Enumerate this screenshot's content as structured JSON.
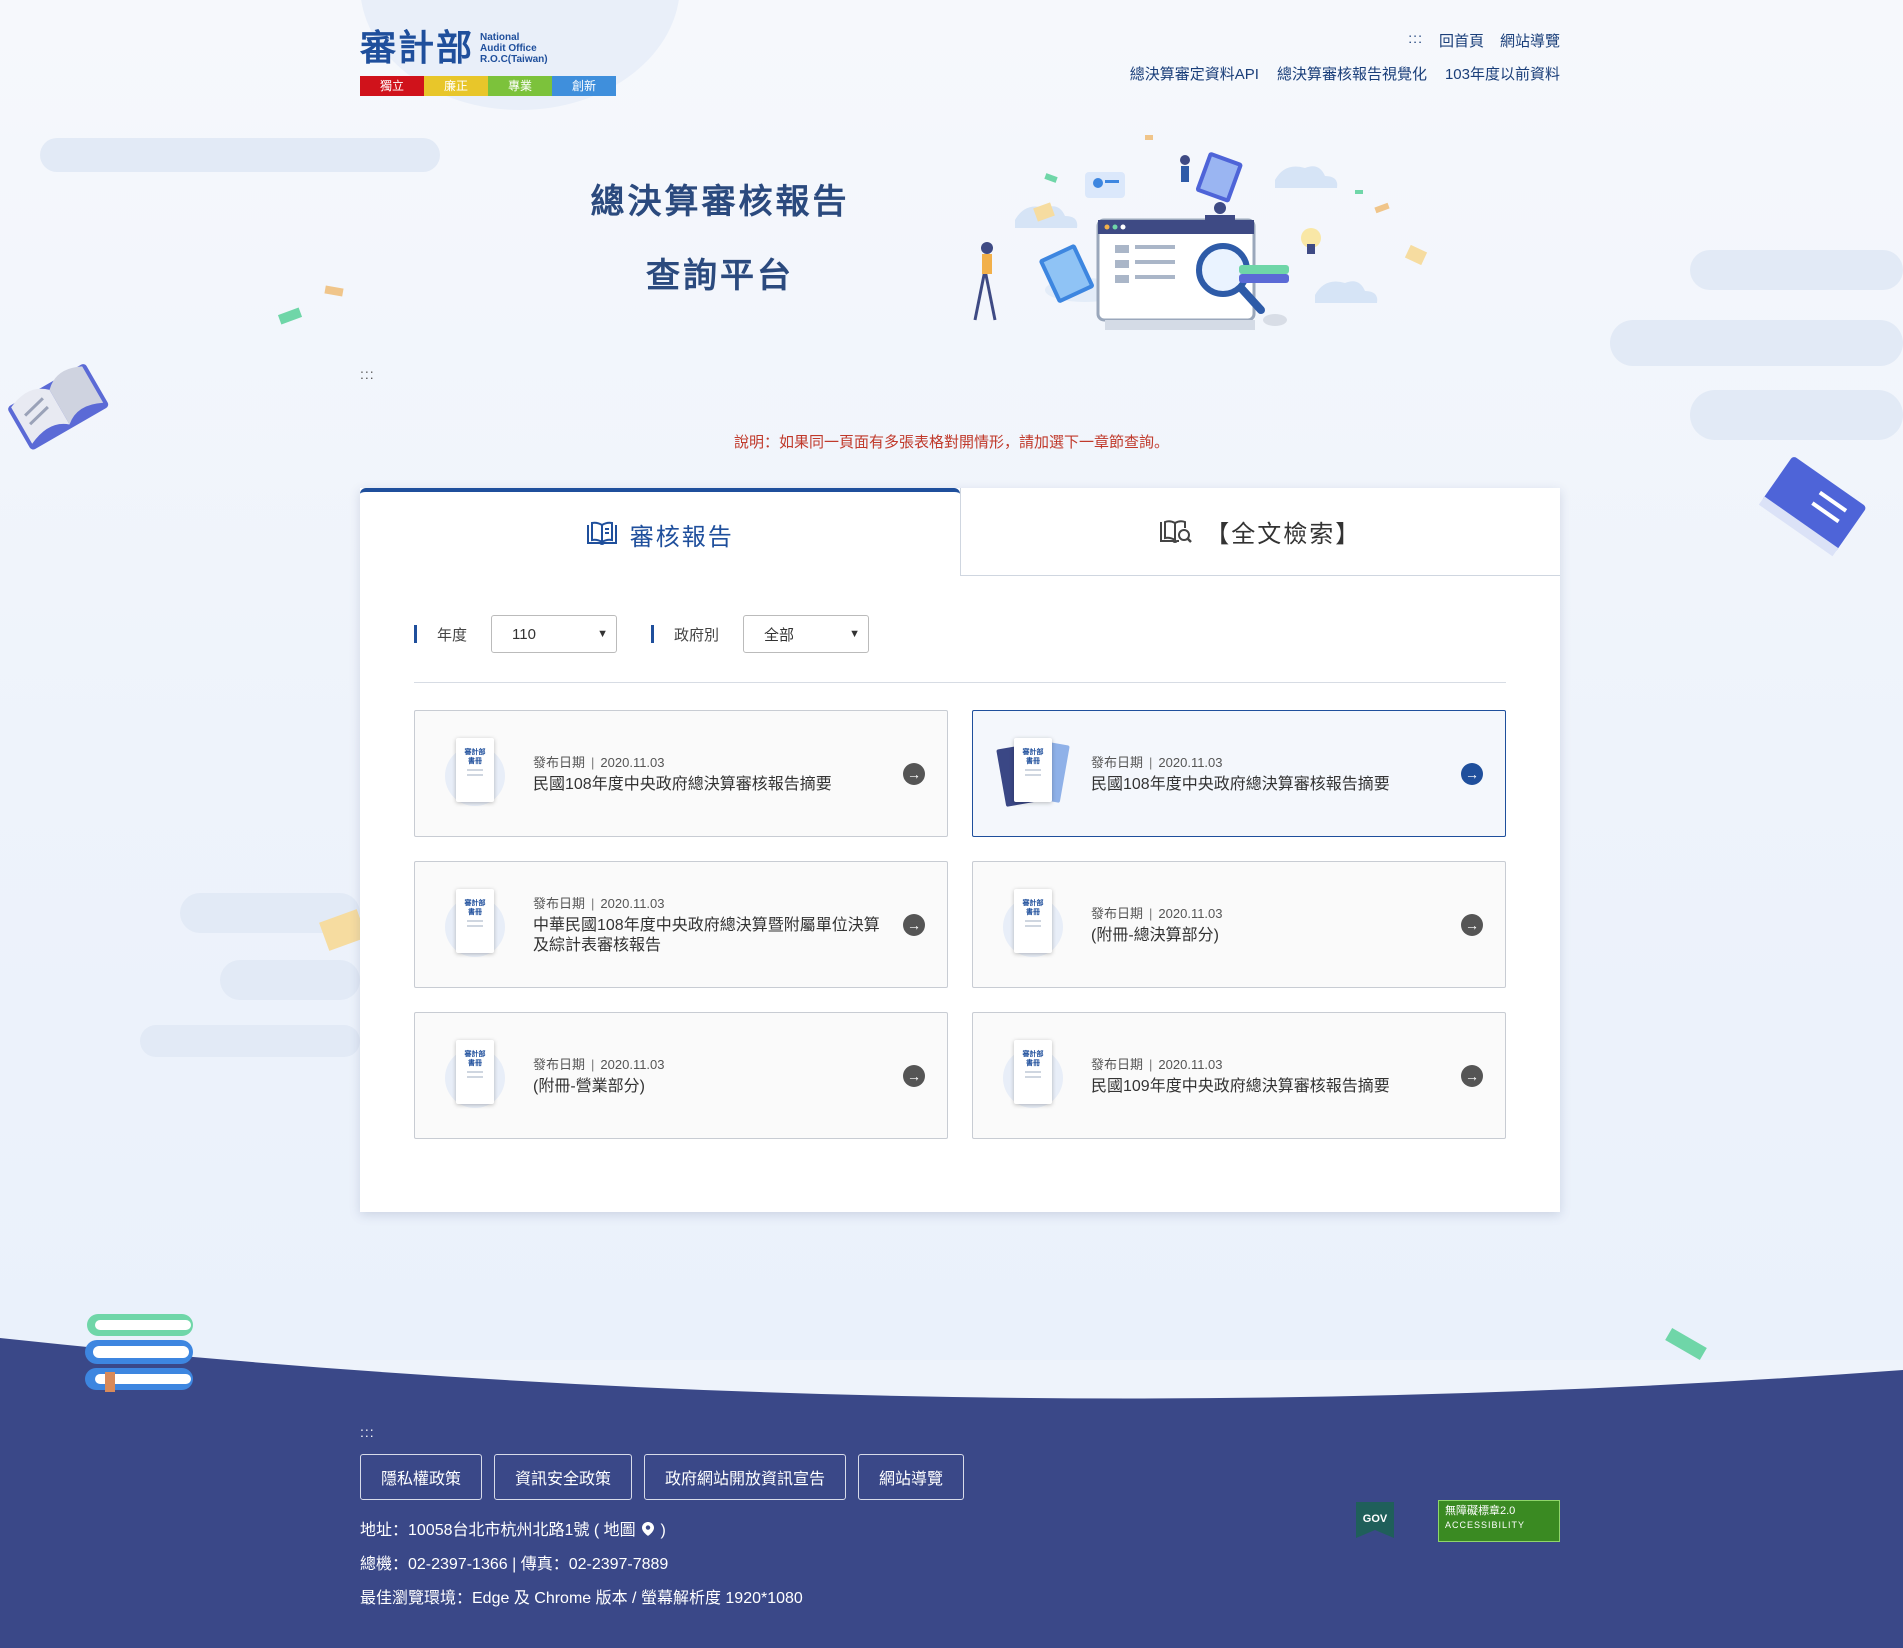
{
  "header": {
    "logo_zh": "審計部",
    "logo_en": [
      "National",
      "Audit Office",
      "R.O.C(Taiwan)"
    ],
    "slogans": [
      {
        "text": "獨立",
        "color": "#d0121b"
      },
      {
        "text": "廉正",
        "color": "#e8c62a"
      },
      {
        "text": "專業",
        "color": "#7cc23b"
      },
      {
        "text": "創新",
        "color": "#3f8fdc"
      }
    ],
    "accesskey": ":::",
    "home_link": "回首頁",
    "sitemap_link": "網站導覽",
    "links": [
      "總決算審定資料API",
      "總決算審核報告視覺化",
      "103年度以前資料"
    ]
  },
  "hero": {
    "title_line1": "總決算審核報告",
    "title_line2": "查詢平台"
  },
  "main_accesskey": ":::",
  "note": "說明：如果同一頁面有多張表格對開情形，請加選下一章節查詢。",
  "tabs": {
    "report_label": "審核報告",
    "search_label": "【全文檢索】"
  },
  "filters": {
    "year_label": "年度",
    "year_value": "110",
    "gov_label": "政府別",
    "gov_value": "全部"
  },
  "reports": [
    {
      "date_label": "發布日期",
      "date": "2020.11.03",
      "icon_label1": "審計部",
      "icon_label2": "書冊",
      "title": "民國108年度中央政府總決算審核報告摘要",
      "highlight": false
    },
    {
      "date_label": "發布日期",
      "date": "2020.11.03",
      "icon_label1": "審計部",
      "icon_label2": "書冊",
      "title": "民國108年度中央政府總決算審核報告摘要",
      "highlight": true
    },
    {
      "date_label": "發布日期",
      "date": "2020.11.03",
      "icon_label1": "審計部",
      "icon_label2": "書冊",
      "title": "中華民國108年度中央政府總決算暨附屬單位決算及綜計表審核報告",
      "highlight": false
    },
    {
      "date_label": "發布日期",
      "date": "2020.11.03",
      "icon_label1": "審計部",
      "icon_label2": "書冊",
      "title": "(附冊-總決算部分)",
      "highlight": false
    },
    {
      "date_label": "發布日期",
      "date": "2020.11.03",
      "icon_label1": "審計部",
      "icon_label2": "書冊",
      "title": "(附冊-營業部分)",
      "highlight": false
    },
    {
      "date_label": "發布日期",
      "date": "2020.11.03",
      "icon_label1": "審計部",
      "icon_label2": "書冊",
      "title": "民國109年度中央政府總決算審核報告摘要",
      "highlight": false
    }
  ],
  "footer": {
    "accesskey": ":::",
    "buttons": [
      "隱私權政策",
      "資訊安全政策",
      "政府網站開放資訊宣告",
      "網站導覽"
    ],
    "address": "地址：10058台北市杭州北路1號 ( 地圖",
    "address_end": ")",
    "phone": "總機：02-2397-1366 | 傳真：02-2397-7889",
    "browser": "最佳瀏覽環境：Edge 及 Chrome 版本 / 螢幕解析度 1920*1080",
    "gov_badge": "GOV",
    "access_badge_line1": "無障礙標章2.0",
    "access_badge_line2": "ACCESSIBILITY"
  },
  "colors": {
    "primary": "#1f4f9c",
    "footer_bg": "#3a4888",
    "note_red": "#c0392b"
  }
}
